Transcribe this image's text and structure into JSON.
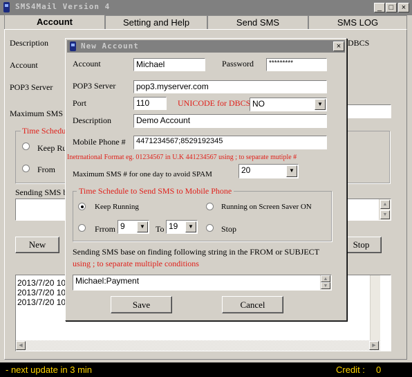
{
  "app": {
    "title": "SMS4Mail Version 4"
  },
  "window_buttons": {
    "minimize": "_",
    "maximize": "□",
    "close": "×"
  },
  "tabs": [
    {
      "label": "Account",
      "active": true
    },
    {
      "label": "Setting and Help"
    },
    {
      "label": "Send SMS"
    },
    {
      "label": "SMS LOG"
    }
  ],
  "background": {
    "description_label": "Description",
    "account_label": "Account",
    "pop3_label": "POP3 Server",
    "max_sms_label": "Maximum SMS #",
    "dbcs_fragment": "DBCS",
    "schedule_label": "Time Schedule",
    "keep_running": "Keep Ru",
    "from_label": "From",
    "sending_label": "Sending SMS b",
    "new_button": "New",
    "stop_button": "Stop",
    "log_lines": [
      "2013/7/20 10:2",
      "2013/7/20 10:2",
      "2013/7/20 10:2"
    ]
  },
  "dialog": {
    "title": "New Account",
    "close": "×",
    "account_label": "Account",
    "account_value": "Michael",
    "password_label": "Password",
    "password_value": "*********",
    "pop3_label": "POP3 Server",
    "pop3_value": "pop3.myserver.com",
    "port_label": "Port",
    "port_value": "110",
    "unicode_label": "UNICODE for DBCS",
    "unicode_value": "NO",
    "description_label": "Description",
    "description_value": "Demo Account",
    "mobile_label": "Mobile Phone #",
    "mobile_value": "4471234567;8529192345",
    "format_hint": "Inetrnational Format eg. 01234567 in U.K 441234567  using ; to separate mutiple #",
    "max_sms_label": "Maximum SMS # for one day to avoid SPAM",
    "max_sms_value": "20",
    "schedule_title": "Time Schedule to Send SMS to Mobile Phone",
    "keep_running": "Keep Running",
    "screen_saver": "Running on Screen Saver ON",
    "from_label": "Frrom",
    "from_value": "9",
    "to_label": "To",
    "to_value": "19",
    "stop_label": "Stop",
    "sending_label": "Sending SMS base on finding following string in the FROM or SUBJECT",
    "sending_hint": "using ; to separate multiple conditions",
    "condition_value": "Michael:Payment",
    "save_button": "Save",
    "cancel_button": "Cancel"
  },
  "status": {
    "text": "- next update in 3 min",
    "credit_label": "Credit :",
    "credit_value": "0"
  },
  "colors": {
    "hint_red": "#e0201a",
    "status_yellow": "#ffd400",
    "title_gray": "#808080"
  }
}
